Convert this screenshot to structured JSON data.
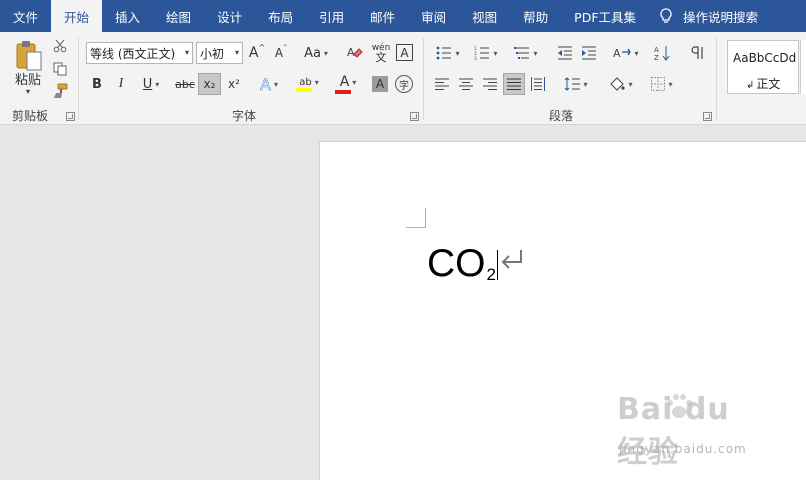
{
  "tabs": [
    "文件",
    "开始",
    "插入",
    "绘图",
    "设计",
    "布局",
    "引用",
    "邮件",
    "审阅",
    "视图",
    "帮助",
    "PDF工具集"
  ],
  "active_tab": "开始",
  "search": {
    "label": "操作说明搜索"
  },
  "clipboard": {
    "paste_label": "粘贴",
    "group_label": "剪贴板",
    "icons": [
      "paste-icon",
      "cut-icon",
      "copy-icon",
      "format-painter-icon"
    ]
  },
  "font": {
    "group_label": "字体",
    "font_name": "等线 (西文正文)",
    "font_size": "小初",
    "grow_label": "A",
    "shrink_label": "A",
    "case_label": "Aa",
    "pinyin_label": "wén",
    "border_char_label": "A",
    "bold_label": "B",
    "italic_label": "I",
    "underline_label": "U",
    "strike_label": "abc",
    "subscript_label": "x₂",
    "superscript_label": "x²",
    "effects_label": "A",
    "highlight_label": "ab",
    "font_color_label": "A",
    "shading_char_label": "A",
    "enclose_label": "字",
    "subscript_active": true,
    "highlight_color": "#ffff00",
    "font_color": "#e31c1c"
  },
  "paragraph": {
    "group_label": "段落",
    "justify_active": true
  },
  "styles": {
    "sample_text": "AaBbCcDd",
    "style_name": "正文"
  },
  "document": {
    "base_text": "CO",
    "subscript_text": "2"
  },
  "watermark": {
    "logo_text": "Bai du 经验",
    "url_text": "jingyan.baidu.com"
  },
  "colors": {
    "ribbon_accent": "#2b579a",
    "ribbon_bg": "#f3f3f3",
    "workspace_bg": "#e6e6e6"
  }
}
